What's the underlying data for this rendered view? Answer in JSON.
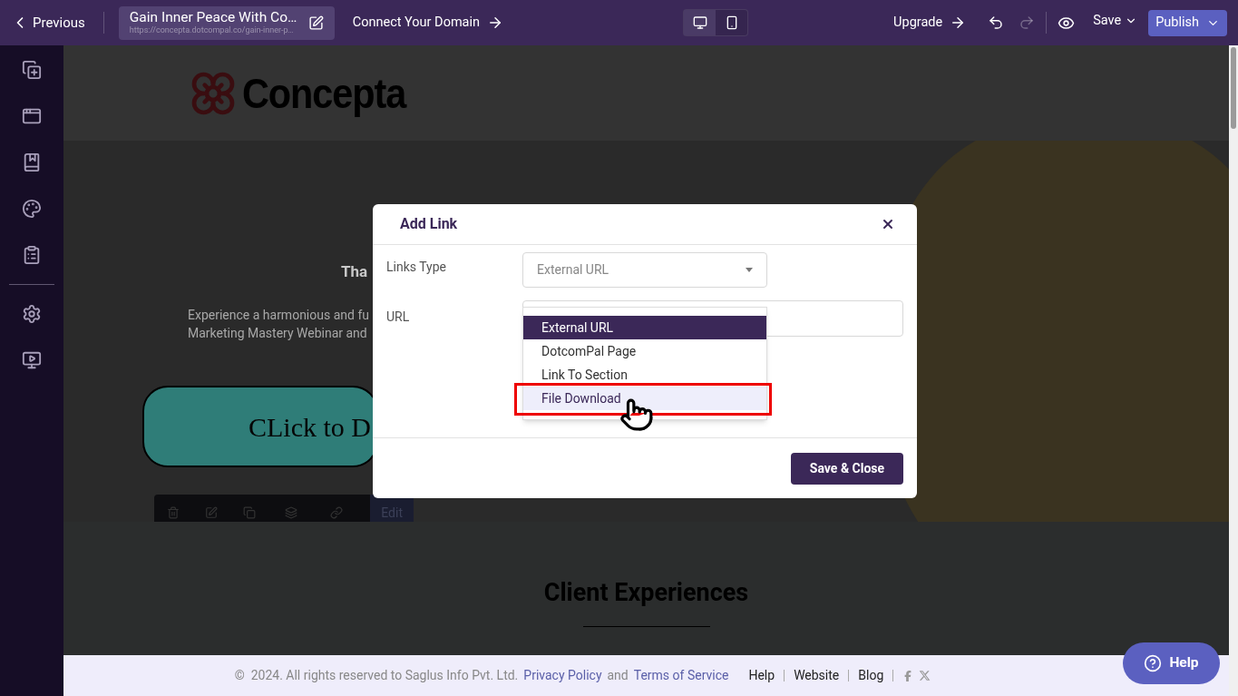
{
  "topbar": {
    "back": "Previous",
    "page_title": "Gain Inner Peace With Co…",
    "page_url": "https://concepta.dotcompal.co/gain-inner-p…",
    "domain_link": "Connect Your Domain",
    "devices": [
      {
        "kind": "desktop",
        "selected": true
      },
      {
        "kind": "mobile",
        "selected": false
      }
    ],
    "upgrade": "Upgrade",
    "redo_disabled": true,
    "save": "Save",
    "publish": "Publish"
  },
  "canvas": {
    "logo": "Concepta",
    "heading_fragment": "Tha",
    "body_lines": [
      "Experience a harmonious and fu",
      "Marketing Mastery Webinar and"
    ],
    "button_text": "CLick to D",
    "toolbar_edit": "Edit",
    "section_title": "Client Experiences"
  },
  "modal": {
    "title": "Add Link",
    "links_type_label": "Links Type",
    "links_type_value": "External URL",
    "url_label": "URL",
    "options": [
      {
        "label": "External URL",
        "selected": true,
        "hovered": false
      },
      {
        "label": "DotcomPal Page",
        "selected": false,
        "hovered": false
      },
      {
        "label": "Link To Section",
        "selected": false,
        "hovered": false
      },
      {
        "label": "File Download",
        "selected": false,
        "hovered": true
      }
    ],
    "save_button": "Save & Close"
  },
  "footer": {
    "copyright": "©  2024. All rights reserved to Saglus Info Pvt. Ltd.",
    "privacy": "Privacy Policy",
    "and": "and",
    "terms": "Terms of Service",
    "links": [
      "Help",
      "Website",
      "Blog"
    ]
  },
  "help_button": "Help"
}
